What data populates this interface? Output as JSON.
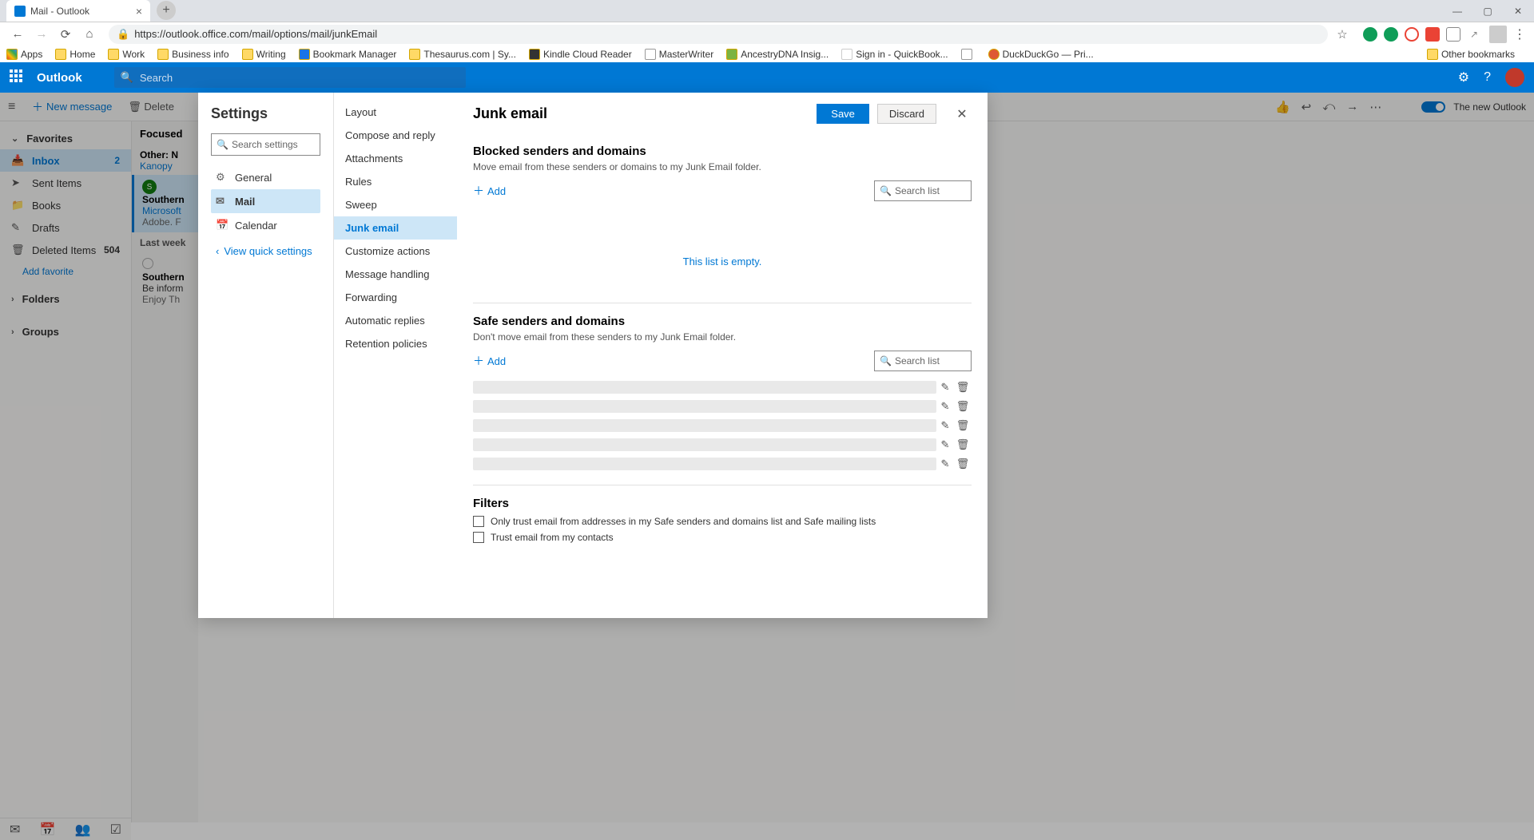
{
  "browser": {
    "tab_title": "Mail -                 Outlook",
    "url": "https://outlook.office.com/mail/options/mail/junkEmail",
    "bookmarks": [
      "Apps",
      "Home",
      "Work",
      "Business info",
      "Writing",
      "Bookmark Manager",
      "Thesaurus.com | Sy...",
      "Kindle Cloud Reader",
      "MasterWriter",
      "AncestryDNA Insig...",
      "Sign in - QuickBook...",
      "",
      "DuckDuckGo — Pri..."
    ],
    "other_bookmarks": "Other bookmarks"
  },
  "header": {
    "app_name": "Outlook",
    "search_placeholder": "Search"
  },
  "cmdbar": {
    "new_message": "New message",
    "delete": "Delete",
    "toggle_label": "The new Outlook"
  },
  "leftRail": {
    "favorites": "Favorites",
    "inbox": "Inbox",
    "inbox_count": "2",
    "sent": "Sent Items",
    "books": "Books",
    "drafts": "Drafts",
    "deleted": "Deleted Items",
    "deleted_count": "504",
    "add_favorite": "Add favorite",
    "folders": "Folders",
    "groups": "Groups"
  },
  "msgList": {
    "focused": "Focused",
    "other_hdr": "Other: N",
    "other_sub": "Kanopy",
    "row1_from": "Southern",
    "row1_sub": "Microsoft",
    "row1_prev": "Adobe. F",
    "last_week": "Last week",
    "row2_from": "Southern",
    "row2_sub": "Be inform",
    "row2_prev": "Enjoy Th"
  },
  "settings": {
    "title": "Settings",
    "search_placeholder": "Search settings",
    "categories": {
      "general": "General",
      "mail": "Mail",
      "calendar": "Calendar"
    },
    "quick": "View quick settings",
    "subs": [
      "Layout",
      "Compose and reply",
      "Attachments",
      "Rules",
      "Sweep",
      "Junk email",
      "Customize actions",
      "Message handling",
      "Forwarding",
      "Automatic replies",
      "Retention policies"
    ],
    "active_sub": "Junk email",
    "panel": {
      "title": "Junk email",
      "save": "Save",
      "discard": "Discard",
      "blocked_title": "Blocked senders and domains",
      "blocked_desc": "Move email from these senders or domains to my Junk Email folder.",
      "add": "Add",
      "search_list": "Search list",
      "empty": "This list is empty.",
      "safe_title": "Safe senders and domains",
      "safe_desc": "Don't move email from these senders to my Junk Email folder.",
      "filters_title": "Filters",
      "filter1": "Only trust email from addresses in my Safe senders and domains list and Safe mailing lists",
      "filter2": "Trust email from my contacts"
    }
  }
}
